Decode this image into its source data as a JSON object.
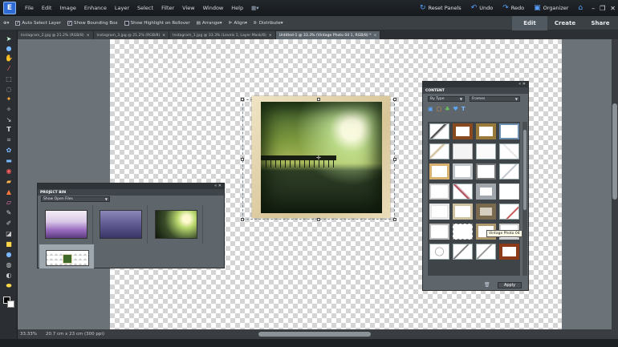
{
  "menubar": {
    "logo": "E",
    "items": [
      "File",
      "Edit",
      "Image",
      "Enhance",
      "Layer",
      "Select",
      "Filter",
      "View",
      "Window",
      "Help"
    ],
    "reset_panels": "Reset Panels",
    "undo": "Undo",
    "redo": "Redo",
    "organizer": "Organizer"
  },
  "options": {
    "auto_select_layer": "Auto Select Layer",
    "show_bounding_box": "Show Bounding Box",
    "show_highlight": "Show Highlight on Rollover",
    "arrange": "Arrange",
    "align": "Align",
    "distribute": "Distribute"
  },
  "modes": [
    "Edit",
    "Create",
    "Share"
  ],
  "doc_tabs": [
    "Instagram_2.jpg @ 21.2% (RGB/8)",
    "Instagram_3.jpg @ 21.2% (RGB/8)",
    "Instagram_1.jpg @ 33.3% (Levels 1, Layer Mask/8)",
    "Untitled-1 @ 33.3% (Vintage Photo 04 1, RGB/8) *"
  ],
  "status": {
    "zoom": "33.33%",
    "size": "20.7 cm x 23 cm (300 ppi)"
  },
  "project_bin": {
    "title": "PROJECT BIN",
    "filter": "Show Open Files"
  },
  "content_panel": {
    "title": "CONTENT",
    "sort": "By Type",
    "category": "Frames",
    "apply": "Apply",
    "tooltip": "Vintage Photo 04"
  },
  "colors": {
    "accent": "#2f6bd4",
    "panel": "#5e656b"
  }
}
